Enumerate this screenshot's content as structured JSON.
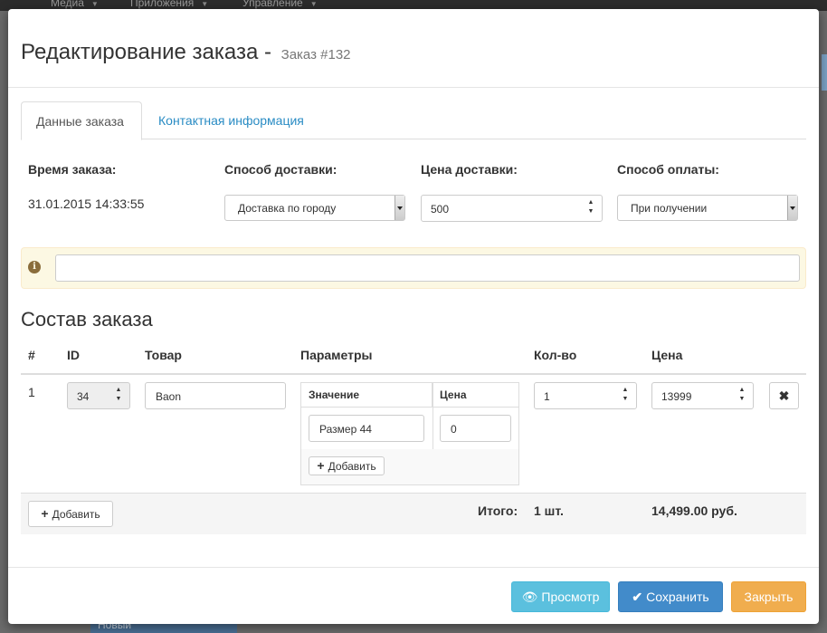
{
  "background": {
    "nav": [
      "Медиа",
      "Приложения",
      "Управление"
    ],
    "badge": "Новый"
  },
  "modal": {
    "title": "Редактирование заказа -",
    "subtitle": "Заказ #132",
    "tabs": [
      "Данные заказа",
      "Контактная информация"
    ]
  },
  "order": {
    "time_label": "Время заказа:",
    "time_value": "31.01.2015 14:33:55",
    "delivery_label": "Способ доставки:",
    "delivery_value": "Доставка по городу",
    "delivery_price_label": "Цена доставки:",
    "delivery_price_value": "500",
    "payment_label": "Способ оплаты:",
    "payment_value": "При получении",
    "comment_value": ""
  },
  "composition": {
    "title": "Состав заказа",
    "headers": [
      "#",
      "ID",
      "Товар",
      "Параметры",
      "Кол-во",
      "Цена"
    ],
    "rows": [
      {
        "num": "1",
        "id": "34",
        "product": "Baon",
        "params_headers": [
          "Значение",
          "Цена"
        ],
        "params": [
          {
            "value": "Размер 44",
            "price": "0"
          }
        ],
        "add_param_label": "Добавить",
        "qty": "1",
        "price": "13999"
      }
    ],
    "add_label": "Добавить",
    "total_label": "Итого:",
    "total_qty": "1 шт.",
    "total_sum": "14,499.00 руб."
  },
  "footer": {
    "preview": "Просмотр",
    "save": "Сохранить",
    "close": "Закрыть"
  },
  "icons": {
    "info": "info-icon",
    "plus": "plus-icon",
    "remove": "remove-icon",
    "eye": "eye-icon",
    "check": "check-icon"
  }
}
